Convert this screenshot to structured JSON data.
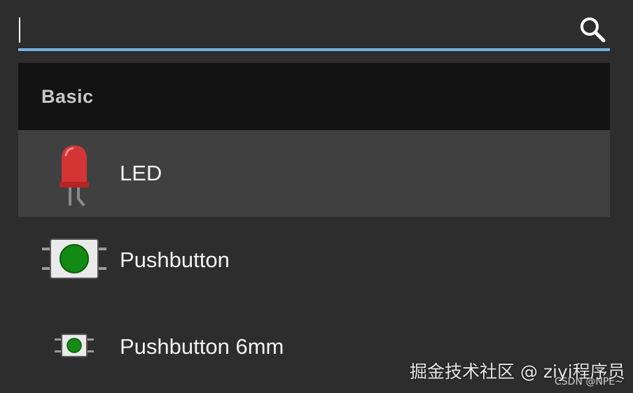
{
  "search": {
    "value": "",
    "placeholder": "",
    "icon": "search-icon",
    "accent_color": "#7ab3e6"
  },
  "list": {
    "section": {
      "label": "Basic"
    },
    "items": [
      {
        "label": "LED",
        "icon": "led-icon",
        "selected": true
      },
      {
        "label": "Pushbutton",
        "icon": "pushbutton-icon",
        "selected": false
      },
      {
        "label": "Pushbutton 6mm",
        "icon": "pushbutton-6mm-icon",
        "selected": false
      }
    ]
  },
  "watermark": {
    "text": "掘金技术社区 @ ziyi程序员",
    "subtext": "CSDN @NPE~"
  }
}
